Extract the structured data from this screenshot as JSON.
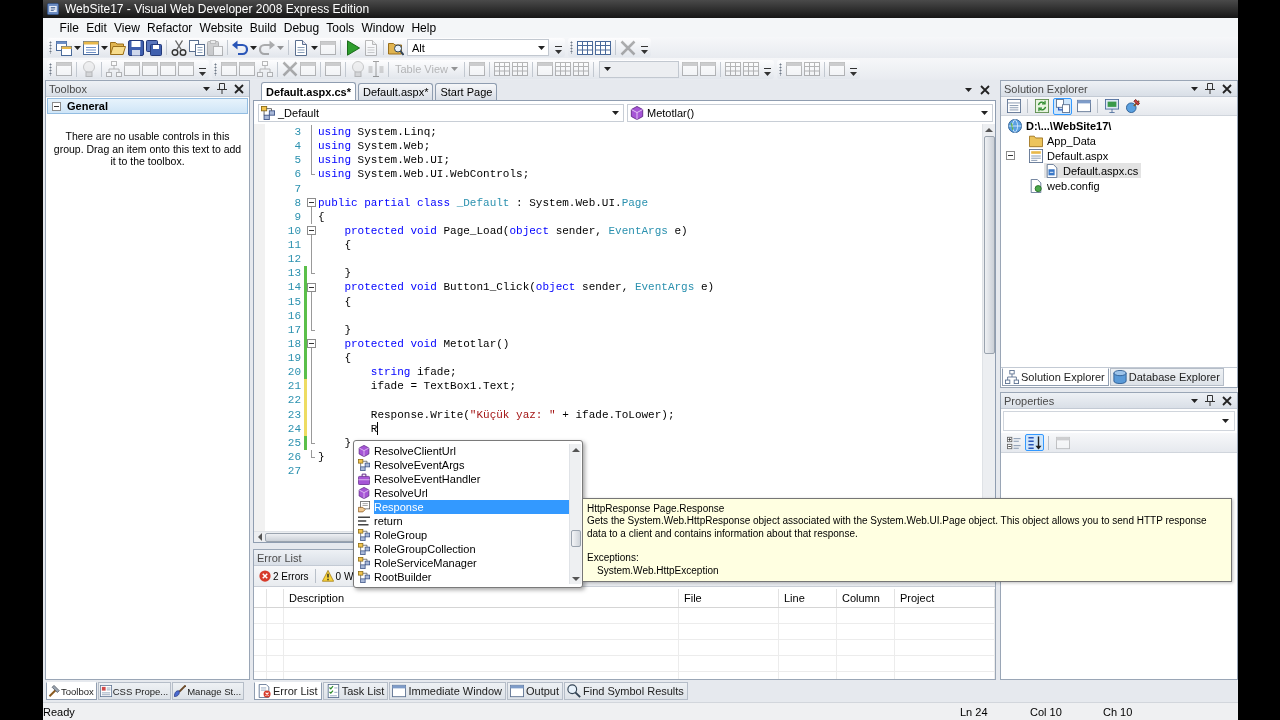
{
  "window": {
    "title": "WebSite17 - Visual Web Developer 2008 Express Edition"
  },
  "menu": [
    "File",
    "Edit",
    "View",
    "Refactor",
    "Website",
    "Build",
    "Debug",
    "Tools",
    "Window",
    "Help"
  ],
  "toolbars": [
    {
      "groups": [
        {
          "items": [
            {
              "kind": "new-project",
              "dropdown": true,
              "disabled": false
            },
            {
              "kind": "add-item",
              "dropdown": true,
              "disabled": false
            },
            {
              "kind": "open",
              "dropdown": false,
              "disabled": false
            },
            {
              "kind": "save",
              "dropdown": false,
              "disabled": false
            },
            {
              "kind": "save-all",
              "dropdown": false,
              "disabled": false
            },
            {
              "kind": "separator"
            },
            {
              "kind": "cut",
              "dropdown": false,
              "disabled": false
            },
            {
              "kind": "copy",
              "dropdown": false,
              "disabled": false
            },
            {
              "kind": "paste",
              "dropdown": false,
              "disabled": true
            },
            {
              "kind": "separator"
            },
            {
              "kind": "undo",
              "dropdown": true,
              "disabled": false
            },
            {
              "kind": "redo",
              "dropdown": true,
              "disabled": true
            },
            {
              "kind": "separator"
            },
            {
              "kind": "page",
              "dropdown": true,
              "disabled": false
            },
            {
              "kind": "window",
              "dropdown": false,
              "disabled": true
            },
            {
              "kind": "separator"
            },
            {
              "kind": "play",
              "dropdown": false,
              "disabled": false
            },
            {
              "kind": "page",
              "dropdown": false,
              "disabled": true
            },
            {
              "kind": "separator"
            },
            {
              "kind": "find",
              "dropdown": false,
              "disabled": false
            },
            {
              "kind": "combo",
              "value": "Alt",
              "disabled": false
            }
          ]
        },
        {
          "items": [
            {
              "kind": "table",
              "dropdown": false,
              "disabled": false
            },
            {
              "kind": "table",
              "dropdown": false,
              "disabled": false
            },
            {
              "kind": "separator"
            },
            {
              "kind": "delete",
              "dropdown": false,
              "disabled": true
            }
          ]
        }
      ]
    },
    {
      "groups": [
        {
          "items": [
            {
              "kind": "window",
              "dropdown": false,
              "disabled": true
            },
            {
              "kind": "separator"
            },
            {
              "kind": "bulb",
              "dropdown": false,
              "disabled": true
            },
            {
              "kind": "separator"
            },
            {
              "kind": "tree",
              "dropdown": false,
              "disabled": true
            },
            {
              "kind": "window",
              "dropdown": false,
              "disabled": true
            },
            {
              "kind": "window",
              "dropdown": false,
              "disabled": true
            },
            {
              "kind": "window",
              "dropdown": false,
              "disabled": true
            },
            {
              "kind": "window",
              "dropdown": false,
              "disabled": true
            }
          ]
        },
        {
          "items": [
            {
              "kind": "window",
              "dropdown": false,
              "disabled": true
            },
            {
              "kind": "window",
              "dropdown": false,
              "disabled": true
            },
            {
              "kind": "tree",
              "dropdown": false,
              "disabled": true
            },
            {
              "kind": "separator"
            },
            {
              "kind": "delete",
              "dropdown": false,
              "disabled": true
            },
            {
              "kind": "window",
              "dropdown": false,
              "disabled": true
            },
            {
              "kind": "separator"
            },
            {
              "kind": "window",
              "dropdown": false,
              "disabled": true
            },
            {
              "kind": "separator"
            },
            {
              "kind": "bulb",
              "dropdown": false,
              "disabled": true
            },
            {
              "kind": "text",
              "dropdown": false,
              "disabled": true
            },
            {
              "kind": "separator"
            },
            {
              "kind": "dropdown",
              "label": "Table View",
              "disabled": true
            },
            {
              "kind": "separator"
            },
            {
              "kind": "window",
              "dropdown": false,
              "disabled": true
            },
            {
              "kind": "separator"
            },
            {
              "kind": "table",
              "dropdown": false,
              "disabled": true
            },
            {
              "kind": "table",
              "dropdown": false,
              "disabled": true
            },
            {
              "kind": "separator"
            },
            {
              "kind": "window",
              "dropdown": false,
              "disabled": true
            },
            {
              "kind": "table",
              "dropdown": false,
              "disabled": true
            },
            {
              "kind": "table",
              "dropdown": false,
              "disabled": true
            },
            {
              "kind": "separator"
            },
            {
              "kind": "combo",
              "disabled": true
            },
            {
              "kind": "window",
              "dropdown": false,
              "disabled": true
            },
            {
              "kind": "window",
              "dropdown": false,
              "disabled": true
            },
            {
              "kind": "separator"
            },
            {
              "kind": "table",
              "dropdown": false,
              "disabled": true
            },
            {
              "kind": "table",
              "dropdown": false,
              "disabled": true
            }
          ]
        },
        {
          "items": [
            {
              "kind": "window",
              "dropdown": false,
              "disabled": true
            },
            {
              "kind": "table",
              "dropdown": false,
              "disabled": true
            },
            {
              "kind": "separator"
            },
            {
              "kind": "window",
              "dropdown": false,
              "disabled": true
            }
          ]
        }
      ]
    }
  ],
  "toolbox": {
    "title": "Toolbox",
    "groups": [
      {
        "name": "General",
        "expanded": true,
        "message": "There are no usable controls in this group. Drag an item onto this text to add it to the toolbox."
      }
    ],
    "tabs": [
      {
        "label": "Toolbox",
        "kind": "toolbox",
        "selected": true
      },
      {
        "label": "CSS Prope...",
        "kind": "css",
        "selected": false
      },
      {
        "label": "Manage St...",
        "kind": "styles",
        "selected": false
      }
    ]
  },
  "editor": {
    "tabs": [
      {
        "label": "Default.aspx.cs*",
        "selected": true
      },
      {
        "label": "Default.aspx*",
        "selected": false
      },
      {
        "label": "Start Page",
        "selected": false
      }
    ],
    "type_dropdown": "_Default",
    "member_dropdown": "Metotlar()",
    "lines": [
      {
        "number": "3",
        "kind": "inner",
        "tokens": [
          {
            "kind": "keyword",
            "text": "using"
          },
          {
            "kind": "plain",
            "text": " System.Linq;"
          }
        ]
      },
      {
        "number": "4",
        "kind": "inner",
        "tokens": [
          {
            "kind": "keyword",
            "text": "using"
          },
          {
            "kind": "plain",
            "text": " System.Web;"
          }
        ]
      },
      {
        "number": "5",
        "kind": "inner",
        "tokens": [
          {
            "kind": "keyword",
            "text": "using"
          },
          {
            "kind": "plain",
            "text": " System.Web.UI;"
          }
        ]
      },
      {
        "number": "6",
        "kind": "end",
        "tokens": [
          {
            "kind": "keyword",
            "text": "using"
          },
          {
            "kind": "plain",
            "text": " System.Web.UI.WebControls;"
          }
        ]
      },
      {
        "number": "7",
        "kind": "plain"
      },
      {
        "number": "8",
        "kind": "start",
        "tokens": [
          {
            "kind": "keyword",
            "text": "public partial class"
          },
          {
            "kind": "type",
            "text": " _Default"
          },
          {
            "kind": "plain",
            "text": " : System.Web.UI."
          },
          {
            "kind": "type",
            "text": "Page"
          }
        ]
      },
      {
        "number": "9",
        "kind": "inner",
        "tokens": [
          {
            "kind": "plain",
            "text": "{"
          }
        ]
      },
      {
        "number": "10",
        "kind": "start",
        "tokens": [
          {
            "kind": "keyword",
            "text": "    protected void"
          },
          {
            "kind": "plain",
            "text": " Page_Load("
          },
          {
            "kind": "keyword",
            "text": "object"
          },
          {
            "kind": "plain",
            "text": " sender, "
          },
          {
            "kind": "type",
            "text": "EventArgs"
          },
          {
            "kind": "plain",
            "text": " e)"
          }
        ]
      },
      {
        "number": "11",
        "kind": "inner",
        "tokens": [
          {
            "kind": "plain",
            "text": "    {"
          }
        ]
      },
      {
        "number": "12",
        "kind": "inner"
      },
      {
        "number": "13",
        "kind": "end",
        "color": "#5bbf4a",
        "tokens": [
          {
            "kind": "plain",
            "text": "    }"
          }
        ]
      },
      {
        "number": "14",
        "kind": "start",
        "color": "#5bbf4a",
        "tokens": [
          {
            "kind": "keyword",
            "text": "    protected void"
          },
          {
            "kind": "plain",
            "text": " Button1_Click("
          },
          {
            "kind": "keyword",
            "text": "object"
          },
          {
            "kind": "plain",
            "text": " sender, "
          },
          {
            "kind": "type",
            "text": "EventArgs"
          },
          {
            "kind": "plain",
            "text": " e)"
          }
        ]
      },
      {
        "number": "15",
        "kind": "inner",
        "color": "#5bbf4a",
        "tokens": [
          {
            "kind": "plain",
            "text": "    {"
          }
        ]
      },
      {
        "number": "16",
        "kind": "inner",
        "color": "#5bbf4a"
      },
      {
        "number": "17",
        "kind": "end",
        "color": "#5bbf4a",
        "tokens": [
          {
            "kind": "plain",
            "text": "    }"
          }
        ]
      },
      {
        "number": "18",
        "kind": "start",
        "color": "#5bbf4a",
        "tokens": [
          {
            "kind": "keyword",
            "text": "    protected void"
          },
          {
            "kind": "plain",
            "text": " Metotlar()"
          }
        ]
      },
      {
        "number": "19",
        "kind": "inner",
        "color": "#5bbf4a",
        "tokens": [
          {
            "kind": "plain",
            "text": "    {"
          }
        ]
      },
      {
        "number": "20",
        "kind": "inner",
        "color": "#5bbf4a",
        "tokens": [
          {
            "kind": "keyword",
            "text": "        string"
          },
          {
            "kind": "plain",
            "text": " ifade;"
          }
        ]
      },
      {
        "number": "21",
        "kind": "inner",
        "color": "#eedc62",
        "tokens": [
          {
            "kind": "plain",
            "text": "        ifade = TextBox1.Text;"
          }
        ]
      },
      {
        "number": "22",
        "kind": "inner",
        "color": "#eedc62"
      },
      {
        "number": "23",
        "kind": "inner",
        "color": "#eedc62",
        "tokens": [
          {
            "kind": "plain",
            "text": "        Response.Write("
          },
          {
            "kind": "string",
            "text": "\"Küçük yaz: \""
          },
          {
            "kind": "plain",
            "text": " + ifade.ToLower);"
          }
        ]
      },
      {
        "number": "24",
        "kind": "inner",
        "color": "#eedc62",
        "tokens": [
          {
            "kind": "plain",
            "text": "        R"
          },
          {
            "kind": "caret"
          }
        ]
      },
      {
        "number": "25",
        "kind": "end",
        "color": "#5bbf4a",
        "tokens": [
          {
            "kind": "plain",
            "text": "    }"
          }
        ]
      },
      {
        "number": "26",
        "kind": "end",
        "tokens": [
          {
            "kind": "plain",
            "text": "}"
          }
        ]
      },
      {
        "number": "27",
        "kind": "plain"
      }
    ]
  },
  "completion": {
    "items": [
      {
        "label": "ResolveClientUrl",
        "kind": "method",
        "selected": false
      },
      {
        "label": "ResolveEventArgs",
        "kind": "class",
        "selected": false
      },
      {
        "label": "ResolveEventHandler",
        "kind": "delegate",
        "selected": false
      },
      {
        "label": "ResolveUrl",
        "kind": "method",
        "selected": false
      },
      {
        "label": "Response",
        "kind": "property",
        "selected": true
      },
      {
        "label": "return",
        "kind": "keyword",
        "selected": false
      },
      {
        "label": "RoleGroup",
        "kind": "class",
        "selected": false
      },
      {
        "label": "RoleGroupCollection",
        "kind": "class",
        "selected": false
      },
      {
        "label": "RoleServiceManager",
        "kind": "class",
        "selected": false
      },
      {
        "label": "RootBuilder",
        "kind": "class",
        "selected": false
      }
    ]
  },
  "tooltip": {
    "signature": "HttpResponse Page.Response",
    "description": "Gets the System.Web.HttpResponse object associated with the System.Web.UI.Page object. This object allows you to send HTTP response data to a client and contains information about that response.",
    "exceptions_label": "Exceptions:",
    "exceptions": [
      "System.Web.HttpException"
    ]
  },
  "error_list": {
    "title": "Error List",
    "filters": [
      {
        "label": "2 Errors",
        "kind": "errors"
      },
      {
        "label": "0 W",
        "kind": "warnings"
      }
    ],
    "columns": [
      "Description",
      "File",
      "Line",
      "Column",
      "Project"
    ],
    "tabs": [
      {
        "label": "Error List",
        "kind": "error-list",
        "selected": true
      },
      {
        "label": "Task List",
        "kind": "task-list",
        "selected": false
      },
      {
        "label": "Immediate Window",
        "kind": "immediate",
        "selected": false
      },
      {
        "label": "Output",
        "kind": "output",
        "selected": false
      },
      {
        "label": "Find Symbol Results",
        "kind": "find-symbol",
        "selected": false
      }
    ]
  },
  "solution_explorer": {
    "title": "Solution Explorer",
    "toolbar": [
      {
        "kind": "properties",
        "pressed": false
      },
      {
        "kind": "separator"
      },
      {
        "kind": "refresh",
        "pressed": false
      },
      {
        "kind": "nest",
        "pressed": true
      },
      {
        "kind": "designer",
        "pressed": false
      },
      {
        "kind": "separator"
      },
      {
        "kind": "copy-website",
        "pressed": false
      },
      {
        "kind": "asp-config",
        "pressed": false
      }
    ],
    "tree": [
      {
        "label": "D:\\...\\WebSite17\\",
        "kind": "project",
        "selected": false,
        "children": [
          {
            "label": "App_Data",
            "kind": "folder",
            "selected": false
          },
          {
            "label": "Default.aspx",
            "kind": "web-form",
            "selected": false,
            "expanded": true,
            "children": [
              {
                "label": "Default.aspx.cs",
                "kind": "code-file",
                "selected": true
              }
            ]
          },
          {
            "label": "web.config",
            "kind": "config-file",
            "selected": false
          }
        ]
      }
    ],
    "tabs": [
      {
        "label": "Solution Explorer",
        "kind": "solution",
        "selected": true
      },
      {
        "label": "Database Explorer",
        "kind": "database",
        "selected": false
      }
    ]
  },
  "properties": {
    "title": "Properties",
    "toolbar": [
      {
        "kind": "categorized",
        "pressed": false,
        "disabled": false
      },
      {
        "kind": "alphabetical",
        "pressed": true,
        "disabled": false
      },
      {
        "kind": "separator"
      },
      {
        "kind": "property-pages",
        "pressed": false,
        "disabled": true
      }
    ]
  },
  "status_bar": {
    "message": "Ready",
    "line": "Ln 24",
    "column": "Col 10",
    "char": "Ch 10"
  }
}
